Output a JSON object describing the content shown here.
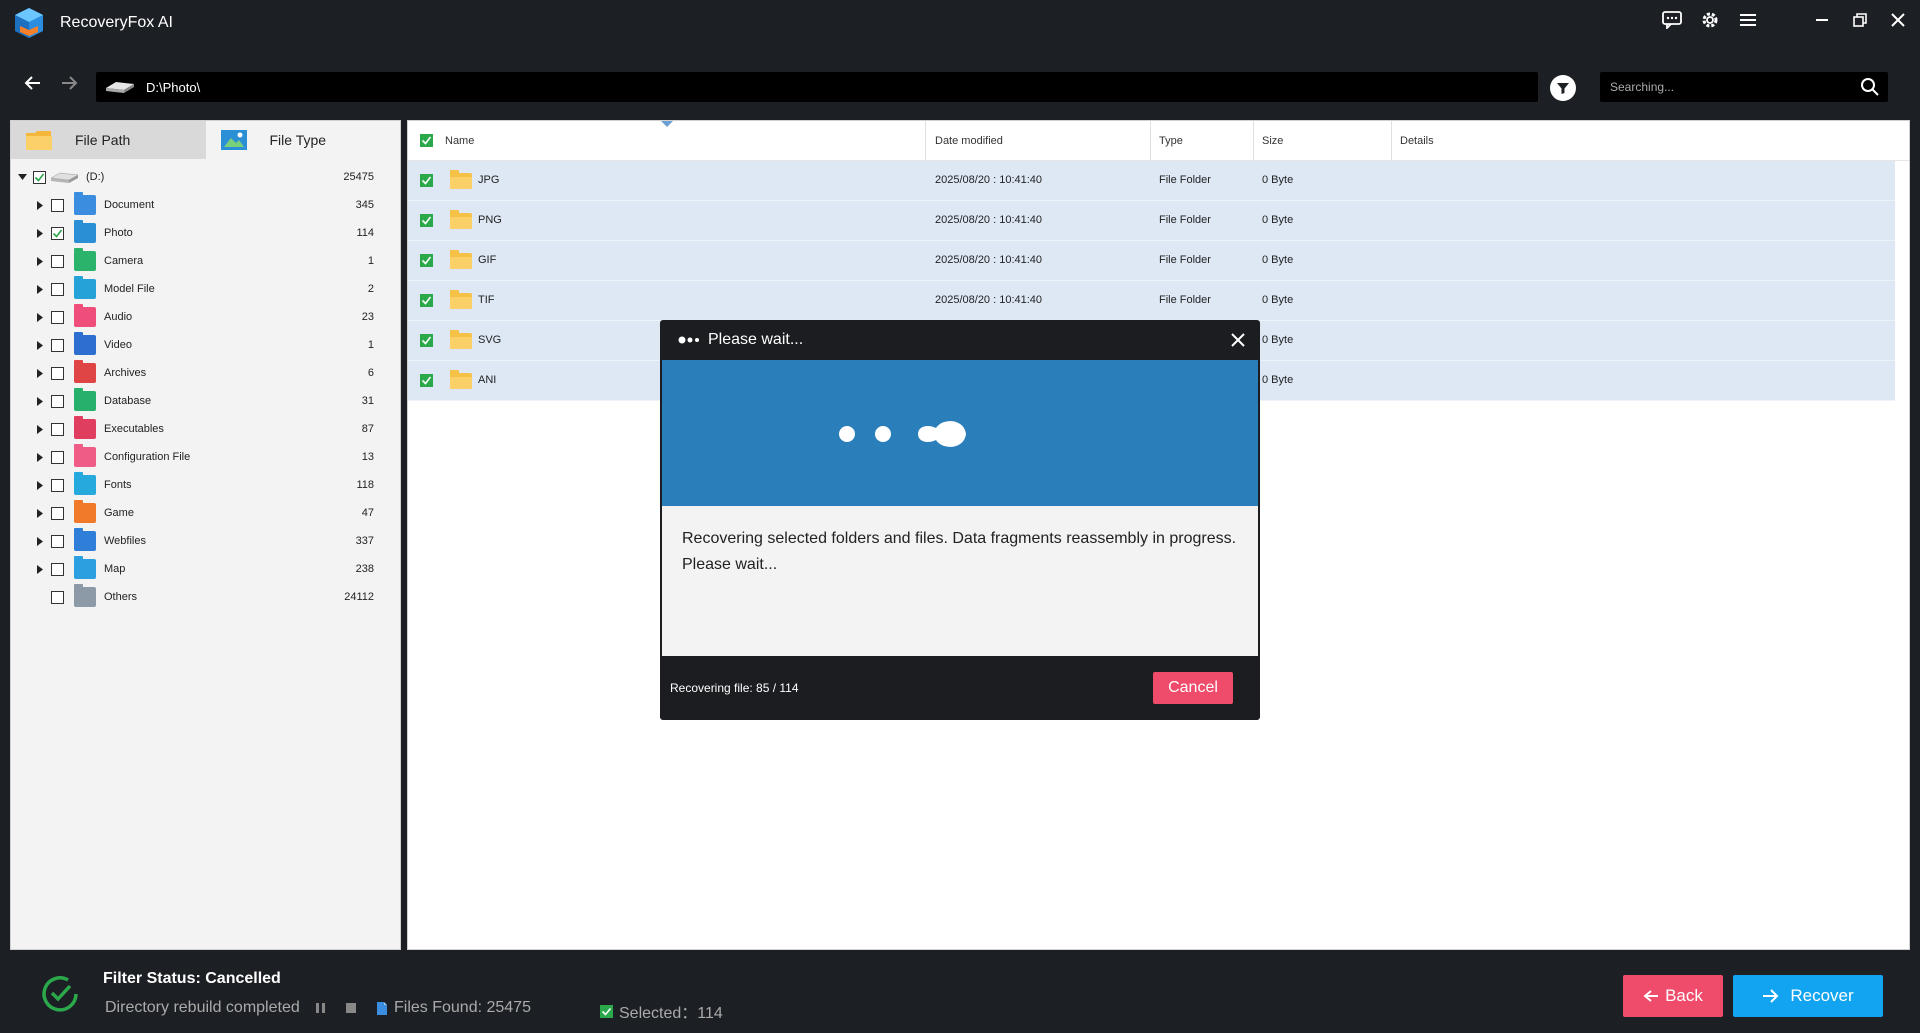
{
  "app": {
    "title": "RecoveryFox AI"
  },
  "address": {
    "path": "D:\\Photo\\",
    "search_placeholder": "Searching..."
  },
  "tabs": [
    {
      "label": "File Path"
    },
    {
      "label": "File Type"
    }
  ],
  "tree": {
    "root": {
      "label": "(D:)",
      "count": "25475"
    },
    "items": [
      {
        "label": "Document",
        "count": "345",
        "color": "#3b8de0",
        "checked": false
      },
      {
        "label": "Photo",
        "count": "114",
        "color": "#2a8fd4",
        "checked": true
      },
      {
        "label": "Camera",
        "count": "1",
        "color": "#2cb36b",
        "checked": false
      },
      {
        "label": "Model File",
        "count": "2",
        "color": "#25a3d8",
        "checked": false
      },
      {
        "label": "Audio",
        "count": "23",
        "color": "#ef4d7a",
        "checked": false
      },
      {
        "label": "Video",
        "count": "1",
        "color": "#2c6fd1",
        "checked": false
      },
      {
        "label": "Archives",
        "count": "6",
        "color": "#e04545",
        "checked": false
      },
      {
        "label": "Database",
        "count": "31",
        "color": "#27b06b",
        "checked": false
      },
      {
        "label": "Executables",
        "count": "87",
        "color": "#e03e5e",
        "checked": false
      },
      {
        "label": "Configuration File",
        "count": "13",
        "color": "#ef5d86",
        "checked": false
      },
      {
        "label": "Fonts",
        "count": "118",
        "color": "#26a9dc",
        "checked": false
      },
      {
        "label": "Game",
        "count": "47",
        "color": "#f07a2a",
        "checked": false
      },
      {
        "label": "Webfiles",
        "count": "337",
        "color": "#2f7fd8",
        "checked": false
      },
      {
        "label": "Map",
        "count": "238",
        "color": "#2b9fe0",
        "checked": false
      },
      {
        "label": "Others",
        "count": "24112",
        "color": "#8c9aa8",
        "checked": false
      }
    ]
  },
  "grid": {
    "headers": {
      "name": "Name",
      "date": "Date modified",
      "type": "Type",
      "size": "Size",
      "details": "Details"
    },
    "rows": [
      {
        "name": "JPG",
        "date": "2025/08/20 : 10:41:40",
        "type": "File Folder",
        "size": "0 Byte"
      },
      {
        "name": "PNG",
        "date": "2025/08/20 : 10:41:40",
        "type": "File Folder",
        "size": "0 Byte"
      },
      {
        "name": "GIF",
        "date": "2025/08/20 : 10:41:40",
        "type": "File Folder",
        "size": "0 Byte"
      },
      {
        "name": "TIF",
        "date": "2025/08/20 : 10:41:40",
        "type": "File Folder",
        "size": "0 Byte"
      },
      {
        "name": "SVG",
        "date": "",
        "type": "",
        "size": "0 Byte"
      },
      {
        "name": "ANI",
        "date": "",
        "type": "",
        "size": "0 Byte"
      }
    ]
  },
  "modal": {
    "title": "Please wait...",
    "message_line1": "Recovering selected folders and files. Data fragments reassembly in progress.",
    "message_line2": "Please wait...",
    "progress": "Recovering file:  85 / 114",
    "cancel_label": "Cancel"
  },
  "status": {
    "title": "Filter Status: Cancelled",
    "rebuild": "Directory rebuild completed",
    "files_found": "Files Found: 25475",
    "selected": "Selected：114",
    "back_label": "Back",
    "recover_label": "Recover"
  },
  "colors": {
    "accent_blue": "#12a4f0",
    "accent_pink": "#ef4b6b",
    "banner": "#2a7fba",
    "row_selected": "#dde8f4"
  }
}
